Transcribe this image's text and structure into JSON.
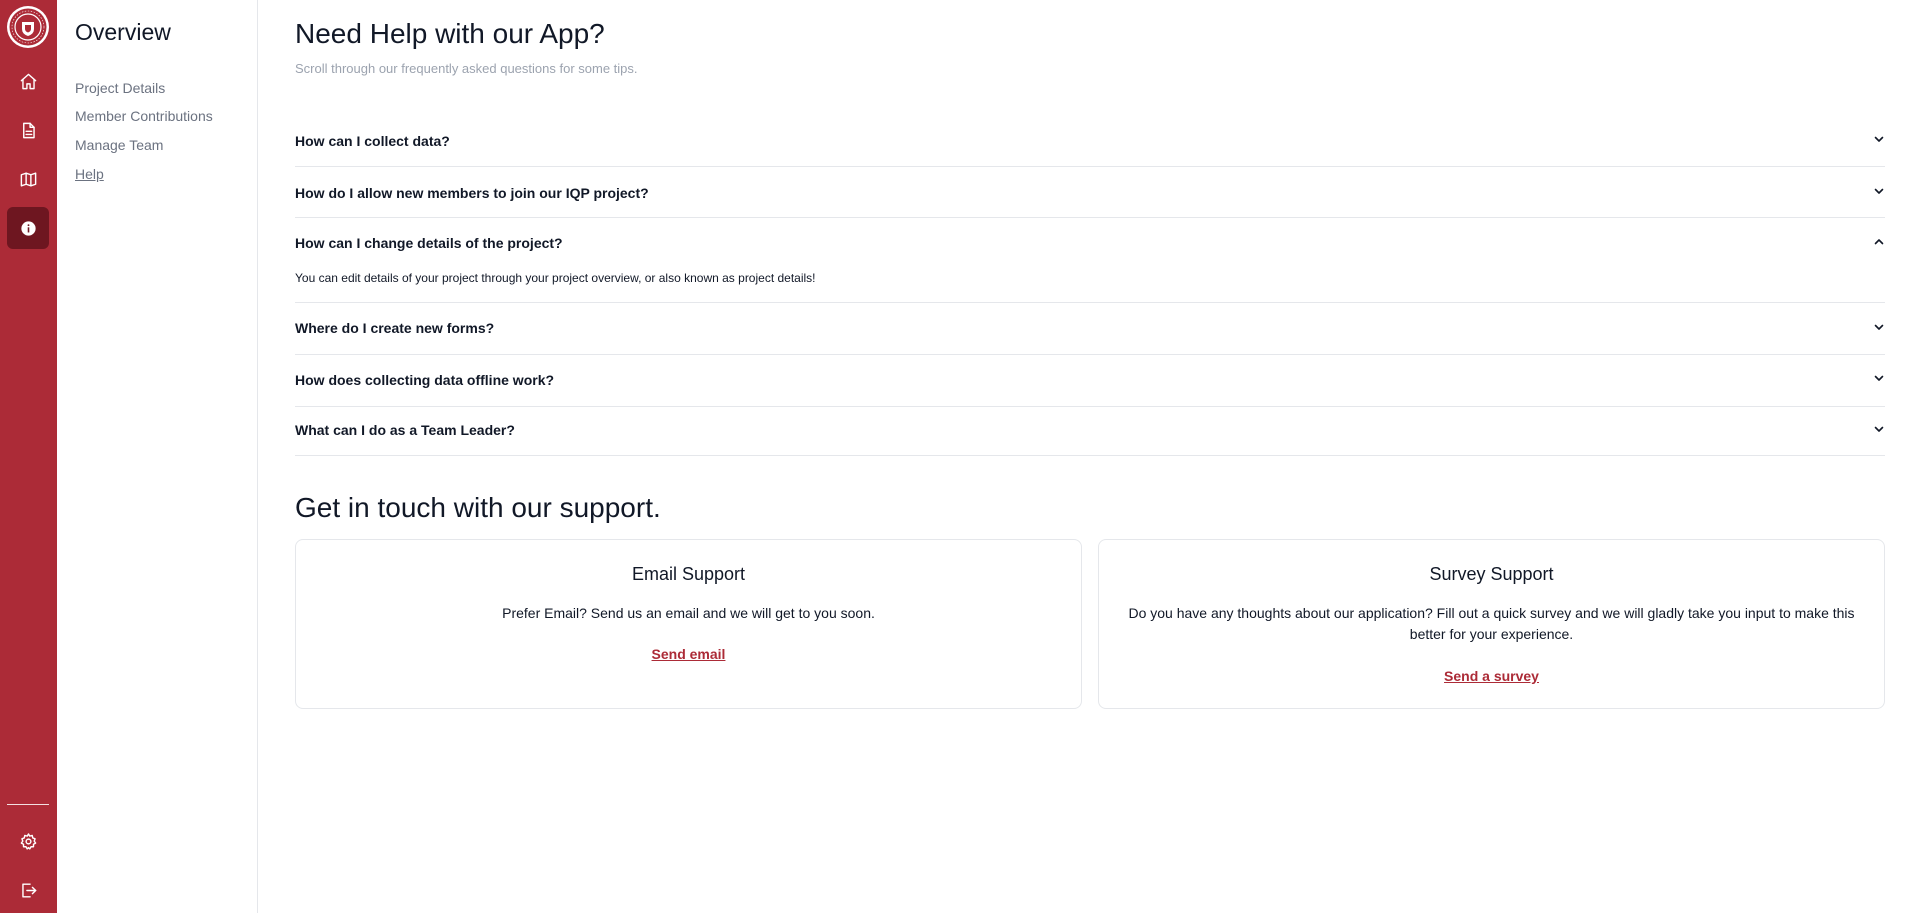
{
  "colors": {
    "brand": "#ac2b37",
    "brand_dark": "#6e1620",
    "muted": "#6b7280"
  },
  "rail": {
    "logo_icon": "university-seal-icon",
    "top_items": [
      {
        "name": "home-icon"
      },
      {
        "name": "document-icon"
      },
      {
        "name": "map-icon"
      },
      {
        "name": "info-icon",
        "active": true
      }
    ],
    "bottom_items": [
      {
        "name": "settings-icon"
      },
      {
        "name": "logout-icon"
      }
    ]
  },
  "sidebar": {
    "title": "Overview",
    "items": [
      {
        "label": "Project Details"
      },
      {
        "label": "Member Contributions"
      },
      {
        "label": "Manage Team"
      },
      {
        "label": "Help",
        "current": true
      }
    ]
  },
  "main": {
    "title": "Need Help with our App?",
    "subtitle": "Scroll through our frequently asked questions for some tips.",
    "faqs": [
      {
        "question": "How can I collect data?",
        "open": false
      },
      {
        "question": "How do I allow new members to join our IQP project?",
        "open": false
      },
      {
        "question": "How can I change details of the project?",
        "open": true,
        "answer": "You can edit details of your project through your project overview, or also known as project details!"
      },
      {
        "question": "Where do I create new forms?",
        "open": false
      },
      {
        "question": "How does collecting data offline work?",
        "open": false
      },
      {
        "question": "What can I do as a Team Leader?",
        "open": false
      }
    ],
    "support_title": "Get in touch with our support.",
    "cards": [
      {
        "title": "Email Support",
        "text": "Prefer Email? Send us an email and we will get to you soon.",
        "link": "Send email"
      },
      {
        "title": "Survey Support",
        "text": "Do you have any thoughts about our application? Fill out a quick survey and we will gladly take you input to make this better for your experience.",
        "link": "Send a survey"
      }
    ]
  }
}
